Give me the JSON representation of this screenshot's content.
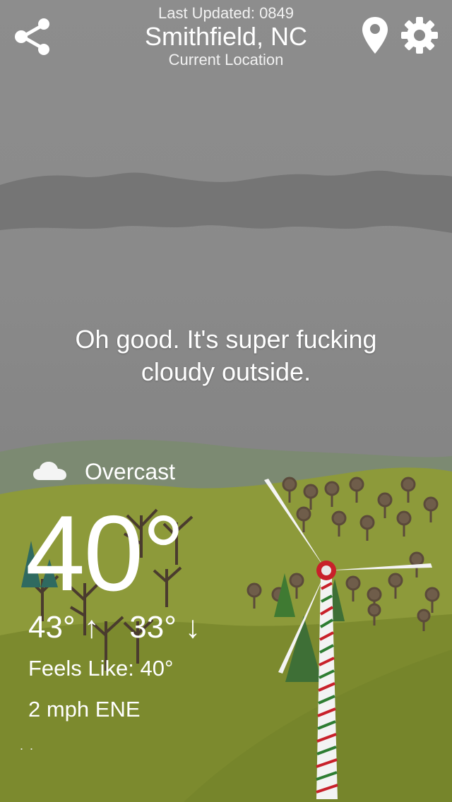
{
  "header": {
    "last_updated": "Last Updated: 0849",
    "city": "Smithfield, NC",
    "location_label": "Current Location",
    "share_icon": "share-icon",
    "location_icon": "location-pin-icon",
    "settings_icon": "gear-icon"
  },
  "message": {
    "line1": "Oh good. It's super fucking",
    "line2": "cloudy outside."
  },
  "weather": {
    "condition_icon": "cloud-icon",
    "condition": "Overcast",
    "temperature": "40°",
    "high": "43°",
    "high_arrow": "↑",
    "low": "33°",
    "low_arrow": "↓",
    "feels_like": "Feels Like: 40°",
    "wind": "2 mph ENE",
    "page_dots": ". ."
  },
  "colors": {
    "sky": "#8a8a8a",
    "cloud_band": "#727272",
    "far_hill": "#7c8a72",
    "mid_hill": "#8f9a3a",
    "near_field": "#7c8a2e",
    "tree_green": "#3e6f36",
    "stripe_red": "#c8202a",
    "stripe_green": "#2e7d32"
  }
}
